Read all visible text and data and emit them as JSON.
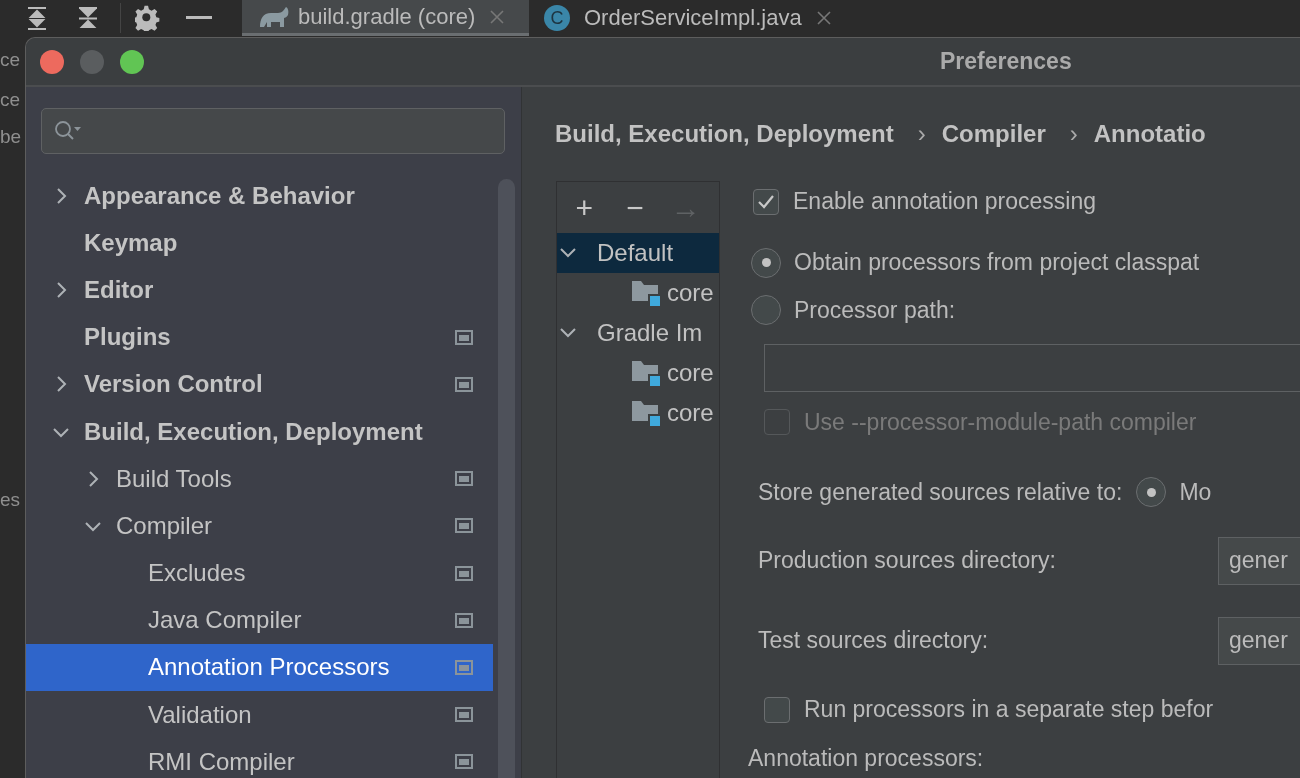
{
  "tabs": [
    {
      "label": "build.gradle (core)",
      "selected": true,
      "kind": "gradle"
    },
    {
      "label": "OrderServiceImpl.java",
      "selected": false,
      "kind": "class",
      "badge": "C"
    }
  ],
  "background_fragments": [
    "ce",
    "ce",
    "be",
    "es"
  ],
  "window": {
    "title": "Preferences"
  },
  "sidebar": {
    "items": [
      {
        "label": "Appearance & Behavior",
        "selected": false,
        "expanded": false,
        "project_level": false
      },
      {
        "label": "Keymap",
        "selected": false,
        "project_level": false
      },
      {
        "label": "Editor",
        "selected": false,
        "expanded": false,
        "project_level": false
      },
      {
        "label": "Plugins",
        "selected": false,
        "project_level": true
      },
      {
        "label": "Version Control",
        "selected": false,
        "expanded": false,
        "project_level": true
      },
      {
        "label": "Build, Execution, Deployment",
        "selected": false,
        "expanded": true,
        "project_level": false,
        "children": [
          {
            "label": "Build Tools",
            "selected": false,
            "expanded": false,
            "project_level": true
          },
          {
            "label": "Compiler",
            "selected": false,
            "expanded": true,
            "project_level": true,
            "children": [
              {
                "label": "Excludes",
                "selected": false,
                "project_level": true
              },
              {
                "label": "Java Compiler",
                "selected": false,
                "project_level": true
              },
              {
                "label": "Annotation Processors",
                "selected": true,
                "project_level": true
              },
              {
                "label": "Validation",
                "selected": false,
                "project_level": true
              },
              {
                "label": "RMI Compiler",
                "selected": false,
                "project_level": true
              }
            ]
          }
        ]
      }
    ]
  },
  "breadcrumb": {
    "separator": "›",
    "items": [
      "Build, Execution, Deployment",
      "Compiler",
      "Annotatio"
    ]
  },
  "profiles": {
    "tools": [
      {
        "symbol": "+",
        "disabled": false
      },
      {
        "symbol": "−",
        "disabled": false
      },
      {
        "symbol": "→",
        "disabled": true
      }
    ],
    "tree": [
      {
        "label": "Default",
        "selected": true,
        "expanded": true,
        "children": [
          {
            "label": "core",
            "selected": false
          }
        ]
      },
      {
        "label": "Gradle Im",
        "selected": false,
        "expanded": true,
        "children": [
          {
            "label": "core",
            "selected": false
          },
          {
            "label": "core",
            "selected": false
          }
        ]
      }
    ]
  },
  "settings": [
    {
      "kind": "checkbox",
      "label": "Enable annotation processing",
      "checked": true,
      "disabled": false
    },
    {
      "kind": "radio",
      "label": "Obtain processors from project classpat",
      "selected": true
    },
    {
      "kind": "radio",
      "label": "Processor path:",
      "selected": false
    },
    {
      "kind": "field"
    },
    {
      "kind": "checkbox",
      "label": "Use --processor-module-path compiler",
      "checked": false,
      "disabled": true
    },
    {
      "kind": "choice",
      "label": "Store generated sources relative to:",
      "option": "Mo",
      "selected": true
    },
    {
      "kind": "labeled_field",
      "label": "Production sources directory:",
      "value": "gener"
    },
    {
      "kind": "labeled_field",
      "label": "Test sources directory:",
      "value": "gener"
    },
    {
      "kind": "checkbox",
      "label": "Run processors in a separate step befor",
      "checked": false,
      "disabled": false
    },
    {
      "kind": "heading",
      "label": "Annotation processors:"
    }
  ]
}
